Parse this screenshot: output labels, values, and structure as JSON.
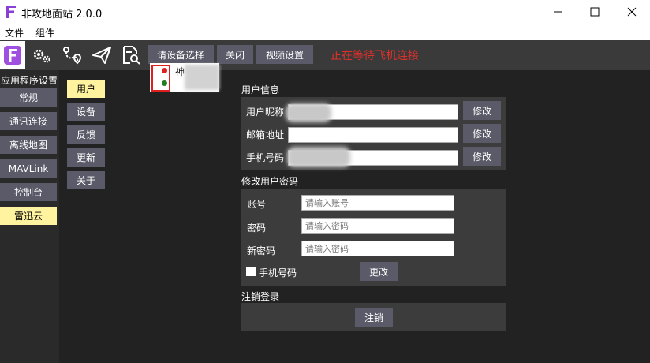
{
  "window": {
    "title": "非攻地面站 2.0.0",
    "controls": {
      "minimize": "—",
      "maximize": "☐",
      "close": "✕"
    }
  },
  "menubar": {
    "items": [
      "文件",
      "组件"
    ]
  },
  "toolbar": {
    "icons": [
      "app-logo-icon",
      "settings-gears-icon",
      "route-plan-icon",
      "send-plane-icon",
      "log-search-icon"
    ],
    "buttons": {
      "device_select": "请设备选择",
      "close": "关闭",
      "video_settings": "视频设置"
    },
    "status": "正在等待飞机连接",
    "status_color": "#e0302a"
  },
  "device_dropdown": {
    "items": [
      {
        "label": "神",
        "dot_color": "#e02020"
      },
      {
        "label": "",
        "dot_color": "#208020"
      }
    ]
  },
  "sidebar": {
    "title": "应用程序设置",
    "items": [
      "常规",
      "通讯连接",
      "离线地图",
      "MAVLink",
      "控制台",
      "雷迅云"
    ],
    "active_index": 5
  },
  "subnav": {
    "items": [
      "用户",
      "设备",
      "反馈",
      "更新",
      "关于"
    ],
    "active_index": 0
  },
  "user_info": {
    "title": "用户信息",
    "nickname_label": "用户昵称",
    "email_label": "邮箱地址",
    "phone_label": "手机号码",
    "edit_label": "修改"
  },
  "change_password": {
    "title": "修改用户密码",
    "account_label": "账号",
    "account_placeholder": "请输入账号",
    "password_label": "密码",
    "password_placeholder": "请输入密码",
    "new_password_label": "新密码",
    "new_password_placeholder": "请输入密码",
    "phone_checkbox_label": "手机号码",
    "change_button": "更改"
  },
  "logout": {
    "title": "注销登录",
    "button": "注销"
  },
  "colors": {
    "accent_active": "#fff3a0",
    "button_bg": "#5a5a68",
    "background": "#222222"
  }
}
